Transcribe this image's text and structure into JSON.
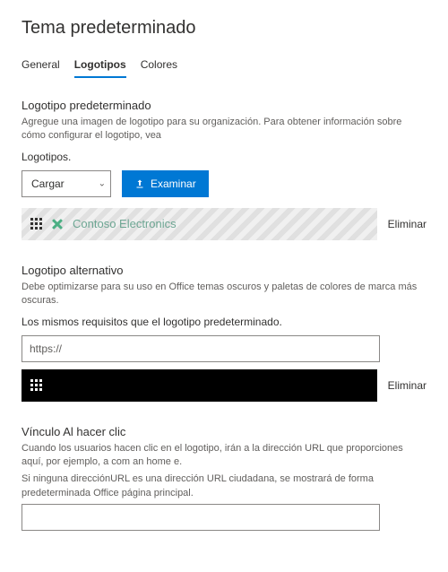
{
  "page_title": "Tema predeterminado",
  "tabs": {
    "general": "General",
    "logotipos": "Logotipos",
    "colores": "Colores"
  },
  "default_logo": {
    "title": "Logotipo predeterminado",
    "desc": "Agregue una imagen de logotipo para su organización. Para obtener información sobre cómo configurar el logotipo, vea",
    "sub": "Logotipos.",
    "select_value": "Cargar",
    "browse_label": "Examinar",
    "preview_name": "Contoso Electronics",
    "remove_label": "Eliminar"
  },
  "alt_logo": {
    "title": "Logotipo alternativo",
    "desc": "Debe optimizarse para su uso en Office temas oscuros y paletas de colores de marca más oscuras.",
    "sub": "Los mismos requisitos que el logotipo predeterminado.",
    "input_value": "https://",
    "remove_label": "Eliminar"
  },
  "link": {
    "title": "Vínculo Al hacer clic",
    "desc": "Cuando los usuarios hacen clic en el logotipo, irán a la dirección URL que proporciones aquí, por ejemplo, a com an home e.",
    "sub": "Si ninguna direcciónURL es una dirección URL ciudadana, se mostrará de forma predeterminada Office página principal.",
    "input_value": ""
  }
}
